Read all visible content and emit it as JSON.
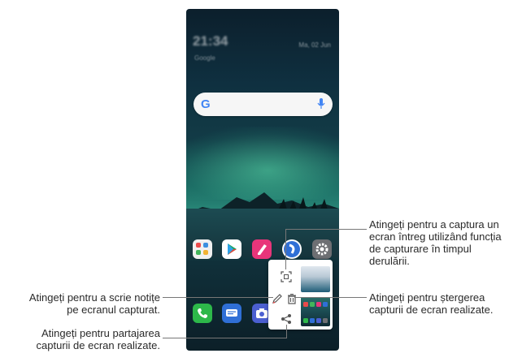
{
  "callouts": {
    "capture_full": "Atingeți pentru a captura un\necran întreg utilizând funcția\nde capturare în timpul\nderulării.",
    "write_notes": "Atingeți pentru a scrie notițe\npe ecranul capturat.",
    "delete": "Atingeți pentru ștergerea\ncapturii de ecran realizate.",
    "share": "Atingeți pentru partajarea\ncapturii de ecran realizate."
  },
  "lockscreen": {
    "clock": "21:34",
    "date": "Ma, 02 Jun",
    "subtitle": "Google"
  },
  "search": {
    "logo": "G"
  },
  "apps": {
    "row1": [
      "gallery-folder-icon",
      "play-store-icon",
      "notes-icon",
      "browser-icon",
      "settings-icon"
    ],
    "dock": [
      "phone-icon",
      "messages-icon",
      "camera-icon"
    ]
  },
  "colors": {
    "search_bg": "#f6f6f6",
    "phone_green": "#2db84a",
    "messages_blue": "#2f6fd6",
    "notes_pink": "#e8357a",
    "settings_gray": "#6d6f73",
    "leader": "#777777"
  }
}
